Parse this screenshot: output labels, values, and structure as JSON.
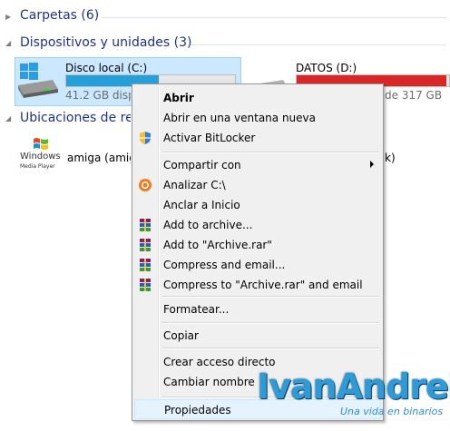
{
  "groups": {
    "folders": {
      "label": "Carpetas (6)"
    },
    "devices": {
      "label": "Dispositivos y unidades (3)"
    },
    "network": {
      "label": "Ubicaciones de red"
    }
  },
  "drives": [
    {
      "name": "Disco local (C:)",
      "size": "41.2 GB disponibles",
      "fill": 0.55,
      "fill_color": "#26a0da"
    },
    {
      "name": "DATOS (D:)",
      "size": "de 317 GB",
      "fill": 0.98,
      "fill_color": "#da2626"
    }
  ],
  "network_items": [
    {
      "name": "amiga (amiga)",
      "suffix": "k)",
      "logo_line1": "Windows",
      "logo_line2": "Media Player"
    }
  ],
  "context_menu": {
    "items": [
      {
        "label": "Abrir",
        "bold": true,
        "icon": ""
      },
      {
        "label": "Abrir en una ventana nueva",
        "icon": ""
      },
      {
        "label": "Activar BitLocker",
        "icon": "shield-icon"
      },
      {
        "label": "Compartir con",
        "icon": "",
        "submenu": true
      },
      {
        "label": "Analizar C:\\",
        "icon": "avast-icon"
      },
      {
        "label": "Anclar a Inicio",
        "icon": ""
      },
      {
        "label": "Add to archive...",
        "icon": "winrar-icon"
      },
      {
        "label": "Add to \"Archive.rar\"",
        "icon": "winrar-icon"
      },
      {
        "label": "Compress and email...",
        "icon": "winrar-icon"
      },
      {
        "label": "Compress to \"Archive.rar\" and email",
        "icon": "winrar-icon"
      },
      {
        "label": "Formatear...",
        "icon": ""
      },
      {
        "label": "Copiar",
        "icon": ""
      },
      {
        "label": "Crear acceso directo",
        "icon": ""
      },
      {
        "label": "Cambiar nombre",
        "icon": ""
      },
      {
        "label": "Propiedades",
        "icon": "",
        "highlighted": true
      }
    ]
  },
  "watermark": {
    "title": "IvanAndrei",
    "subtitle": "Una vida en binarios"
  }
}
